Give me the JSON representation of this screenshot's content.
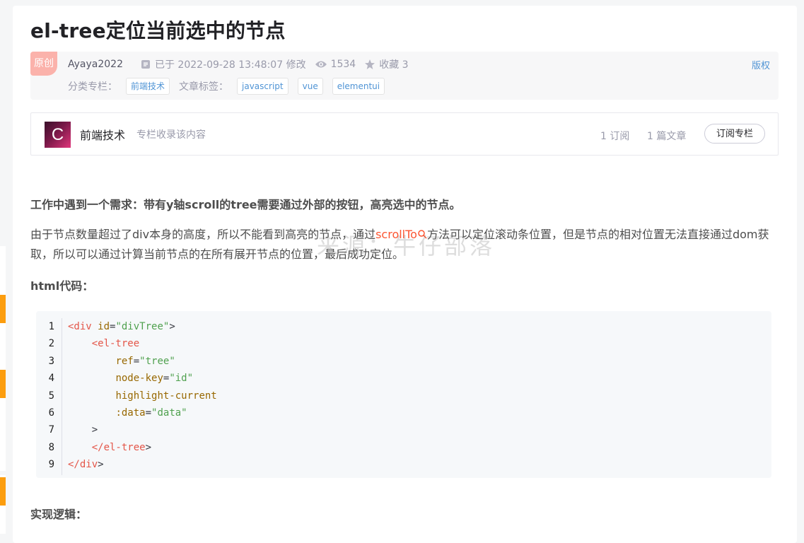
{
  "title": "el-tree定位当前选中的节点",
  "meta": {
    "badge": "原创",
    "author": "Ayaya2022",
    "status": "已于 2022-09-28 13:48:07 修改",
    "views": "1534",
    "favorites_label": "收藏 3",
    "rights": "版权",
    "category_label": "分类专栏：",
    "category": "前端技术",
    "tags_label": "文章标签：",
    "tags": [
      "javascript",
      "vue",
      "elementui"
    ]
  },
  "column": {
    "logo_letter": "C",
    "name": "前端技术",
    "desc": "专栏收录该内容",
    "subscribers": "1 订阅",
    "articles": "1 篇文章",
    "subscribe_button": "订阅专栏"
  },
  "content": {
    "p1": "工作中遇到一个需求：带有y轴scroll的tree需要通过外部的按钮，高亮选中的节点。",
    "p2_before": "由于节点数量超过了div本身的高度，所以不能看到高亮的节点，通过",
    "p2_link": "scrollTo",
    "p2_after": "方法可以定位滚动条位置，但是节点的相对位置无法直接通过dom获取，所以可以通过计算当前节点的在所有展开节点的位置，最后成功定位。",
    "html_heading": "html代码：",
    "logic_heading": "实现逻辑：",
    "watermark": "来源：牛仔部落"
  },
  "code": {
    "line_numbers": [
      "1",
      "2",
      "3",
      "4",
      "5",
      "6",
      "7",
      "8",
      "9"
    ],
    "lines": [
      {
        "p1": "",
        "tag": "<div",
        "attr": " id",
        "eq": "=",
        "str": "\"divTree\"",
        "end": ">"
      },
      {
        "p1": "    ",
        "tag": "<el-tree",
        "attr": "",
        "eq": "",
        "str": "",
        "end": ""
      },
      {
        "p1": "        ",
        "tag": "",
        "attr": "ref",
        "eq": "=",
        "str": "\"tree\"",
        "end": ""
      },
      {
        "p1": "        ",
        "tag": "",
        "attr": "node-key",
        "eq": "=",
        "str": "\"id\"",
        "end": ""
      },
      {
        "p1": "        ",
        "tag": "",
        "attr": "highlight-current",
        "eq": "",
        "str": "",
        "end": ""
      },
      {
        "p1": "        ",
        "tag": "",
        "attr": ":data",
        "eq": "=",
        "str": "\"data\"",
        "end": ""
      },
      {
        "p1": "    ",
        "tag": "",
        "attr": "",
        "eq": "",
        "str": "",
        "end": ">"
      },
      {
        "p1": "    ",
        "tag": "</el-tree",
        "attr": "",
        "eq": "",
        "str": "",
        "end": ">"
      },
      {
        "p1": "",
        "tag": "</div",
        "attr": "",
        "eq": "",
        "str": "",
        "end": ">"
      }
    ]
  }
}
